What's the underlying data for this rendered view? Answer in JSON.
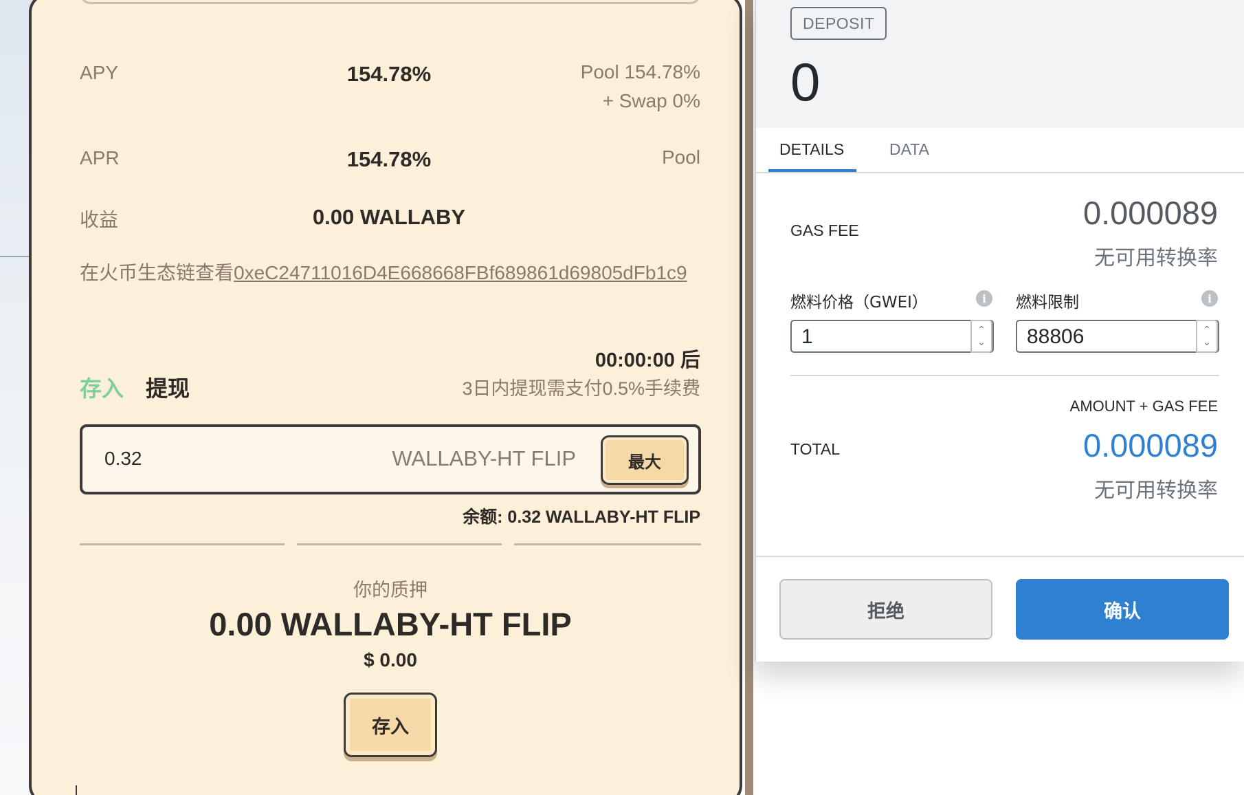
{
  "dapp": {
    "rows": {
      "apy": {
        "label": "APY",
        "value": "154.78%",
        "detail_line1": "Pool 154.78%",
        "detail_line2": "+ Swap 0%"
      },
      "apr": {
        "label": "APR",
        "value": "154.78%",
        "detail": "Pool"
      },
      "earnings": {
        "label": "收益",
        "value": "0.00 WALLABY"
      }
    },
    "explorer": {
      "prefix": "在火币生态链查看",
      "address": "0xeC24711016D4E668668FBf689861d69805dFb1c9"
    },
    "countdown": "00:00:00 后",
    "withdraw_fee_note": "3日内提现需支付0.5%手续费",
    "tabs": {
      "deposit": "存入",
      "withdraw": "提现"
    },
    "amount_input": {
      "value": "0.32",
      "unit": "WALLABY-HT FLIP",
      "max_label": "最大"
    },
    "balance": "余额: 0.32 WALLABY-HT FLIP",
    "stake": {
      "label": "你的质押",
      "amount": "0.00 WALLABY-HT FLIP",
      "usd": "$ 0.00",
      "deposit_button": "存入"
    }
  },
  "metamask": {
    "tx_type": "DEPOSIT",
    "amount": "0",
    "tabs": {
      "details": "DETAILS",
      "data": "DATA",
      "active": "details"
    },
    "gas_fee": {
      "label": "GAS FEE",
      "value": "0.000089",
      "conversion": "无可用转换率"
    },
    "gas_price": {
      "label": "燃料价格（GWEI）",
      "value": "1"
    },
    "gas_limit": {
      "label": "燃料限制",
      "value": "88806"
    },
    "total": {
      "heading": "AMOUNT + GAS FEE",
      "label": "TOTAL",
      "value": "0.000089",
      "conversion": "无可用转换率"
    },
    "buttons": {
      "reject": "拒绝",
      "confirm": "确认"
    },
    "colors": {
      "accent": "#2f80d1"
    }
  },
  "icons": [
    "info-icon",
    "chevron-up-icon",
    "chevron-down-icon"
  ]
}
